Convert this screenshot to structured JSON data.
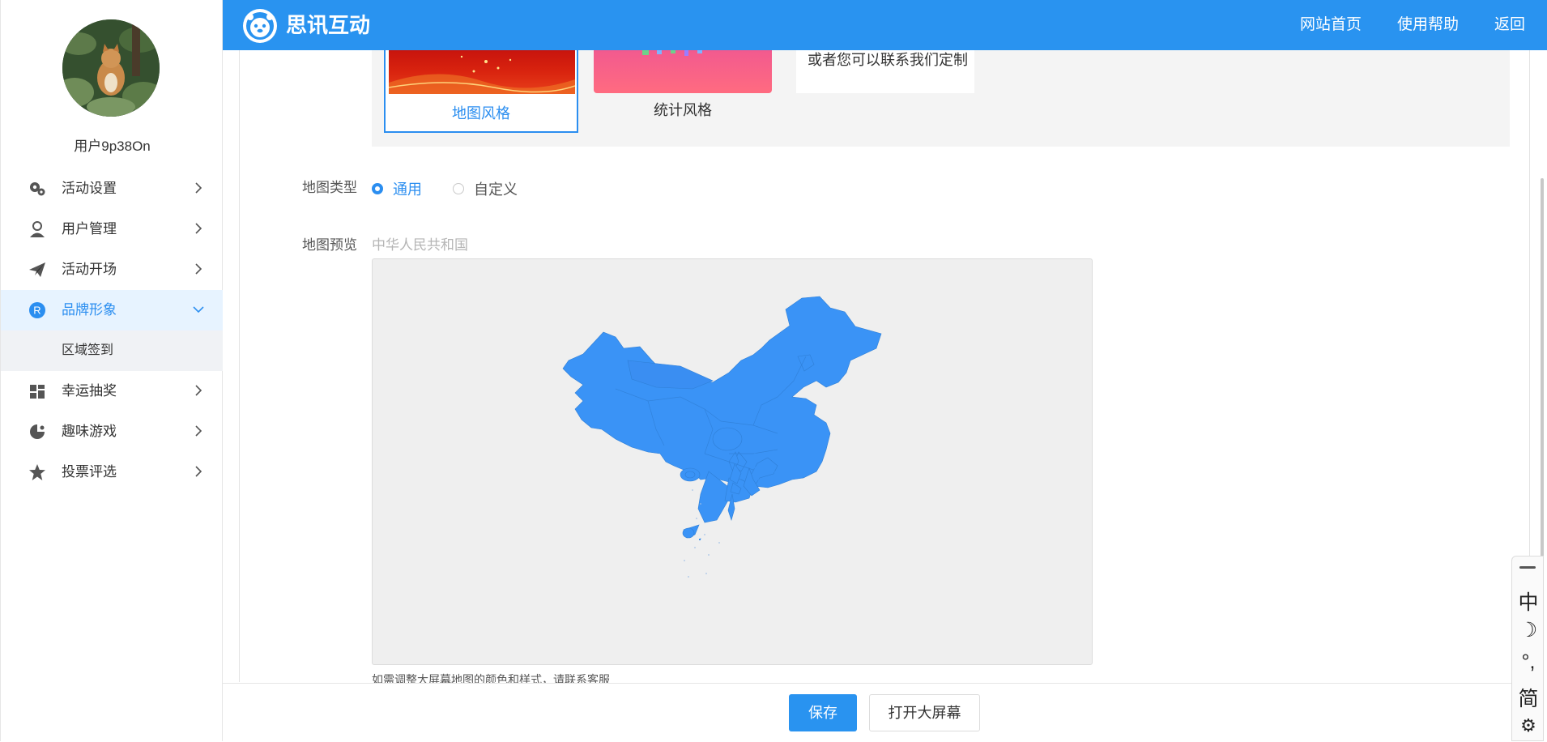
{
  "sidebar": {
    "username": "用户9p38On",
    "items": [
      {
        "label": "活动设置",
        "icon": "gears-icon"
      },
      {
        "label": "用户管理",
        "icon": "user-icon"
      },
      {
        "label": "活动开场",
        "icon": "paper-plane-icon"
      },
      {
        "label": "品牌形象",
        "icon": "brand-r-icon",
        "active": true
      },
      {
        "label": "幸运抽奖",
        "icon": "gift-icon"
      },
      {
        "label": "趣味游戏",
        "icon": "game-icon"
      },
      {
        "label": "投票评选",
        "icon": "star-icon"
      }
    ],
    "sub_item": "区域签到"
  },
  "header": {
    "brand": "思讯互动",
    "nav": [
      "网站首页",
      "使用帮助",
      "返回"
    ],
    "color": "#2993f0"
  },
  "style_cards": {
    "card1_label": "地图风格",
    "card2_label": "统计风格",
    "card3_text": "或者您可以联系我们定制"
  },
  "form": {
    "map_type_label": "地图类型",
    "map_type_options": [
      "通用",
      "自定义"
    ],
    "map_type_selected": "通用",
    "preview_label": "地图预览",
    "map_name": "中华人民共和国",
    "hint": "如需调整大屏幕地图的颜色和样式，请联系客服",
    "map_color": "#3a93f6"
  },
  "footer": {
    "save": "保存",
    "open_screen": "打开大屏幕"
  },
  "ime": {
    "items": [
      "中",
      "☽",
      "°,",
      "简",
      "⚙"
    ]
  }
}
